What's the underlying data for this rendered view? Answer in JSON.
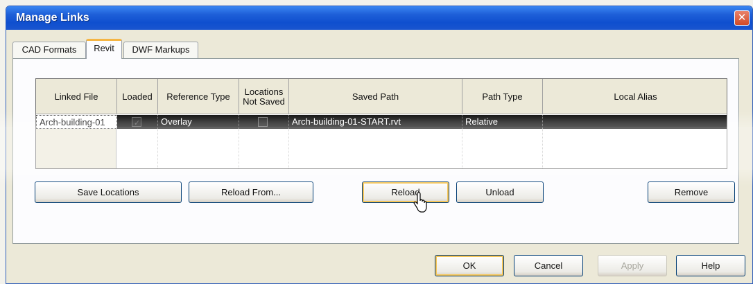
{
  "window": {
    "title": "Manage Links",
    "close_glyph": "✕"
  },
  "tabs": [
    {
      "label": "CAD Formats",
      "active": false
    },
    {
      "label": "Revit",
      "active": true
    },
    {
      "label": "DWF Markups",
      "active": false
    }
  ],
  "table": {
    "columns": [
      "Linked File",
      "Loaded",
      "Reference Type",
      "Locations Not Saved",
      "Saved Path",
      "Path Type",
      "Local Alias"
    ],
    "rows": [
      {
        "linked_file": "Arch-building-01",
        "loaded": true,
        "reference_type": "Overlay",
        "locations_not_saved": false,
        "saved_path": "Arch-building-01-START.rvt",
        "path_type": "Relative",
        "local_alias": ""
      }
    ]
  },
  "panel_buttons": {
    "save_locations": "Save Locations",
    "reload_from": "Reload From...",
    "reload": "Reload",
    "unload": "Unload",
    "remove": "Remove"
  },
  "footer_buttons": {
    "ok": "OK",
    "cancel": "Cancel",
    "apply": "Apply",
    "help": "Help"
  },
  "colors": {
    "title_bar": "#0f4fcf",
    "selected_row": "#000000",
    "active_tab_accent": "#f5b544"
  }
}
